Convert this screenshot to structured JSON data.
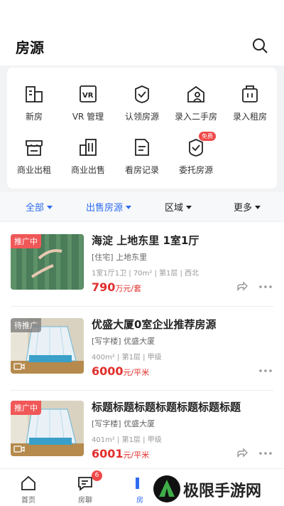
{
  "header": {
    "title": "房源"
  },
  "grid": [
    {
      "label": "新房",
      "icon": "building-icon"
    },
    {
      "label": "VR 管理",
      "icon": "vr-icon"
    },
    {
      "label": "认领房源",
      "icon": "shield-check-icon"
    },
    {
      "label": "录入二手房",
      "icon": "house-user-icon"
    },
    {
      "label": "录入租房",
      "icon": "key-icon"
    },
    {
      "label": "商业出租",
      "icon": "shop-icon"
    },
    {
      "label": "商业出售",
      "icon": "office-icon"
    },
    {
      "label": "看房记录",
      "icon": "document-icon"
    },
    {
      "label": "委托房源",
      "icon": "shield-star-icon",
      "badge": "免费"
    }
  ],
  "filters": [
    {
      "label": "全部",
      "active": true
    },
    {
      "label": "出售房源",
      "active": true
    },
    {
      "label": "区域",
      "active": false
    },
    {
      "label": "更多",
      "active": false
    }
  ],
  "listings": [
    {
      "tag": "推广中",
      "tag_type": "promo",
      "title": "海淀 上地东里 1室1厅",
      "sub": "[住宅] 上地东里",
      "meta": "1室1厅1卫 | 70m² | 第1层 | 西北",
      "price": "790",
      "unit": "万元/套"
    },
    {
      "tag": "待推广",
      "tag_type": "pending",
      "title": "优盛大厦0室企业推荐房源",
      "sub": "[写字楼] 优盛大厦",
      "meta": "400m² | 第1层 | 甲级",
      "price": "6000",
      "unit": "元/平米"
    },
    {
      "tag": "推广中",
      "tag_type": "promo",
      "title": "标题标题标题标题标题标题标题",
      "sub": "[写字楼] 优盛大厦",
      "meta": "401m² | 第1层 | 甲级",
      "price": "6001",
      "unit": "元/平米"
    }
  ],
  "tabbar": {
    "home": "首页",
    "chat": "房聊",
    "chat_count": "6",
    "house": "房"
  },
  "watermark": "极限手游网",
  "colors": {
    "accent": "#2e6cf0",
    "price": "#e0302e",
    "promo_tag": "#f05858"
  }
}
